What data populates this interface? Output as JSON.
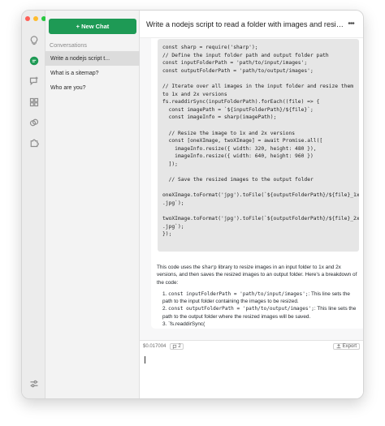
{
  "sidebar": {
    "new_chat_label": "+ New Chat",
    "section_label": "Conversations",
    "conversations": [
      {
        "label": "Write a nodejs script t..."
      },
      {
        "label": "What is a sitemap?"
      },
      {
        "label": "Who are you?"
      }
    ]
  },
  "rail": {
    "icons": [
      "lightbulb-icon",
      "chat-icon",
      "chat-plus-icon",
      "grid-icon",
      "connections-icon",
      "puzzle-icon",
      "sliders-icon"
    ],
    "active_color": "#1e9a55"
  },
  "header": {
    "title": "Write a nodejs script to read a folder with images and resize those ima...",
    "menu_glyph": "•••"
  },
  "messages": {
    "code": "const sharp = require('sharp');\n// Define the input folder path and output folder path\nconst inputFolderPath = 'path/to/input/images';\nconst outputFolderPath = 'path/to/output/images';\n\n// Iterate over all images in the input folder and resize them\nto 1x and 2x versions\nfs.readdirSync(inputFolderPath).forEach((file) => {\n  const imagePath = `${inputFolderPath}/${file}`;\n  const imageInfo = sharp(imagePath);\n\n  // Resize the image to 1x and 2x versions\n  const [oneXImage, twoXImage] = await Promise.all([\n    imageInfo.resize({ width: 320, height: 480 }),\n    imageInfo.resize({ width: 640, height: 960 })\n  ]);\n\n  // Save the resized images to the output folder\n\noneXImage.toFormat('jpg').toFile(`${outputFolderPath}/${file}_1x\n.jpg`);\n\ntwoXImage.toFormat('jpg').toFile(`${outputFolderPath}/${file}_2x\n.jpg`);\n});",
    "explanation_before": "This code uses the ",
    "explanation_code": "sharp",
    "explanation_after": " library to resize images in an input folder to 1x and 2x versions, and then saves the resized images to an output folder. Here's a breakdown of the code:",
    "breakdown": [
      {
        "num": "1.",
        "code": "const inputFolderPath = 'path/to/input/images';",
        "text": ": This line sets the path to the input folder containing the images to be resized."
      },
      {
        "num": "2.",
        "code": "const outputFolderPath = 'path/to/output/images';",
        "text": ": This line sets the path to the output folder where the resized images will be saved."
      },
      {
        "num": "3.",
        "code": "",
        "text": "`fs.readdirSync("
      }
    ]
  },
  "toolbar": {
    "cost": "$0.017004",
    "tokens": "2",
    "export_label": "Export"
  },
  "input": {
    "value": ""
  }
}
